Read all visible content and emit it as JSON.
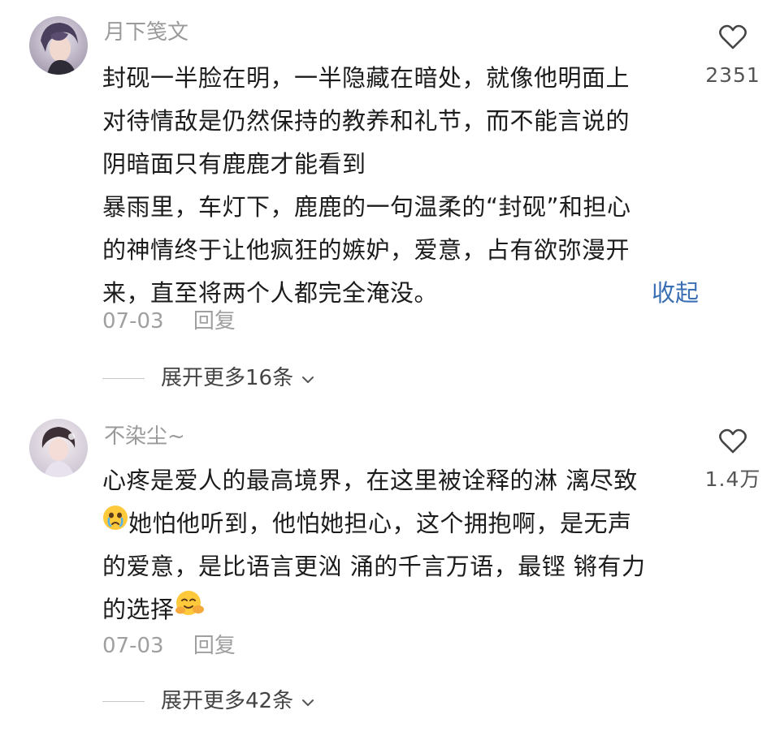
{
  "comments": [
    {
      "username": "月下笺文",
      "lines": [
        "封砚一半脸在明，一半隐藏在暗处，就像他明面上",
        "对待情敌是仍然保持的教养和礼节，而不能言说的",
        "阴暗面只有鹿鹿才能看到",
        "暴雨里，车灯下，鹿鹿的一句温柔的“封砚”和担心",
        "的神情终于让他疯狂的嫉妒，爱意，占有欲弥漫开",
        "来，直至将两个人都完全淹没。"
      ],
      "collapse_label": "收起",
      "date": "07-03",
      "reply_label": "回复",
      "likes": "2351",
      "expand_label": "展开更多16条"
    },
    {
      "username": "不染尘~",
      "lines": [
        "心疼是爱人的最高境界，在这里被诠释的淋 漓尽致",
        "她怕他听到，他怕她担心，这个拥抱啊，是无声",
        "的爱意，是比语言更汹 涌的千言万语，最铿 锵有力",
        "的选择"
      ],
      "date": "07-03",
      "reply_label": "回复",
      "likes": "1.4万",
      "expand_label": "展开更多42条"
    }
  ]
}
